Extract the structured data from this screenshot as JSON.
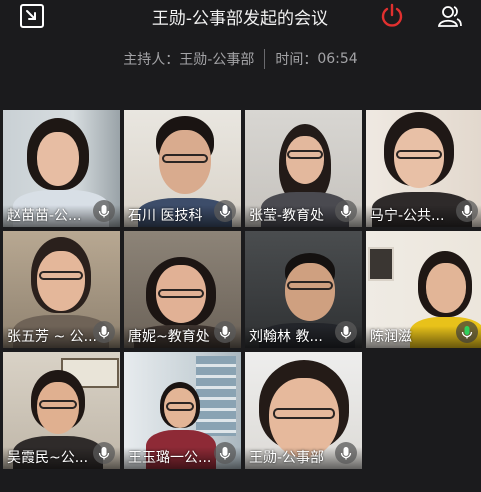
{
  "meeting": {
    "title": "王勋-公事部发起的会议",
    "host_label": "主持人：",
    "host_name": "王勋-公事部",
    "time_label": "时间：",
    "time_value": "06:54"
  },
  "icons": {
    "minimize": "minimize-window-icon",
    "leave": "power-leave-icon",
    "members": "participants-icon",
    "mic": "microphone-icon"
  },
  "colors": {
    "background": "#1b1b1d",
    "leave_red": "#e0302f",
    "mic_green": "#2fcf5b"
  },
  "participants": [
    {
      "name": "赵苗苗-公..."
    },
    {
      "name": "石川 医技科"
    },
    {
      "name": "张莹-教育处"
    },
    {
      "name": "马宁-公共..."
    },
    {
      "name": "张五芳 ~ 公..."
    },
    {
      "name": "唐妮~教育处"
    },
    {
      "name": "刘翰林 教..."
    },
    {
      "name": "陈润滋"
    },
    {
      "name": "吴霞民~公..."
    },
    {
      "name": "王玉璐一公..."
    },
    {
      "name": "王勋-公事部"
    }
  ]
}
